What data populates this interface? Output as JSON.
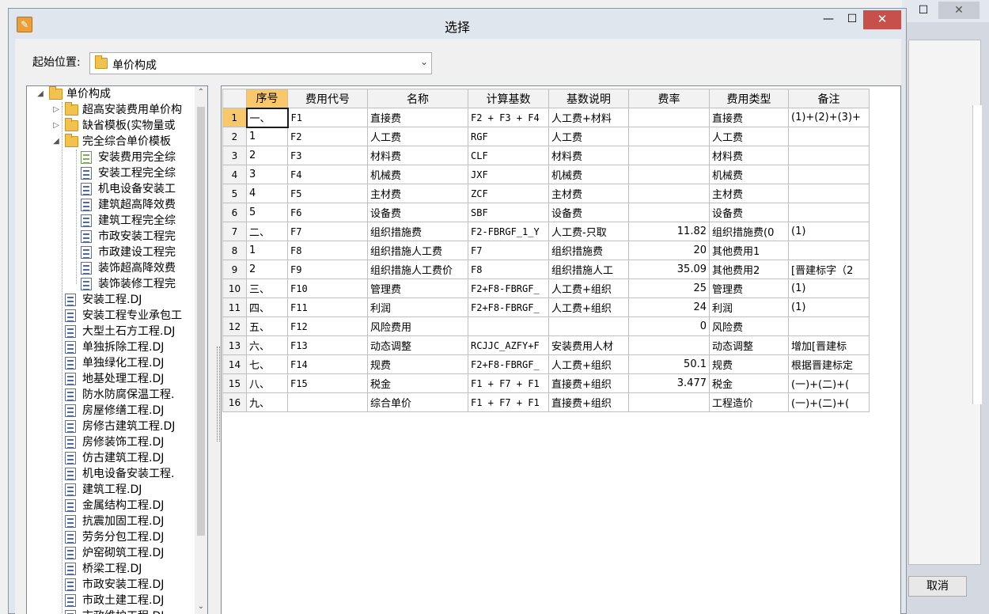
{
  "dialog": {
    "title": "选择",
    "icon": "app-icon",
    "min_label": "—",
    "max_label": "☐",
    "close_label": "✕"
  },
  "background_window": {
    "min_label": "☐",
    "close_label": "✕",
    "cancel_label": "取消"
  },
  "location": {
    "label": "起始位置:",
    "value": "单价构成"
  },
  "tree": {
    "root": "单价构成",
    "nodes": [
      {
        "label": "超高安装费用单价构",
        "type": "folder",
        "level": 1,
        "expander": "collapsed"
      },
      {
        "label": "缺省模板(实物量或",
        "type": "folder",
        "level": 1,
        "expander": "collapsed"
      },
      {
        "label": "完全综合单价模板",
        "type": "folder",
        "level": 1,
        "expander": "expanded"
      },
      {
        "label": "安装费用完全综",
        "type": "doc-green",
        "level": 2
      },
      {
        "label": "安装工程完全综",
        "type": "doc",
        "level": 2
      },
      {
        "label": "机电设备安装工",
        "type": "doc",
        "level": 2
      },
      {
        "label": "建筑超高降效费",
        "type": "doc",
        "level": 2
      },
      {
        "label": "建筑工程完全综",
        "type": "doc",
        "level": 2
      },
      {
        "label": "市政安装工程完",
        "type": "doc",
        "level": 2
      },
      {
        "label": "市政建设工程完",
        "type": "doc",
        "level": 2
      },
      {
        "label": "装饰超高降效费",
        "type": "doc",
        "level": 2
      },
      {
        "label": "装饰装修工程完",
        "type": "doc",
        "level": 2
      },
      {
        "label": "安装工程.DJ",
        "type": "doc",
        "level": 1
      },
      {
        "label": "安装工程专业承包工",
        "type": "doc",
        "level": 1
      },
      {
        "label": "大型土石方工程.DJ",
        "type": "doc",
        "level": 1
      },
      {
        "label": "单独拆除工程.DJ",
        "type": "doc",
        "level": 1
      },
      {
        "label": "单独绿化工程.DJ",
        "type": "doc",
        "level": 1
      },
      {
        "label": "地基处理工程.DJ",
        "type": "doc",
        "level": 1
      },
      {
        "label": "防水防腐保温工程.",
        "type": "doc",
        "level": 1
      },
      {
        "label": "房屋修缮工程.DJ",
        "type": "doc",
        "level": 1
      },
      {
        "label": "房修古建筑工程.DJ",
        "type": "doc",
        "level": 1
      },
      {
        "label": "房修装饰工程.DJ",
        "type": "doc",
        "level": 1
      },
      {
        "label": "仿古建筑工程.DJ",
        "type": "doc",
        "level": 1
      },
      {
        "label": "机电设备安装工程.",
        "type": "doc",
        "level": 1
      },
      {
        "label": "建筑工程.DJ",
        "type": "doc",
        "level": 1
      },
      {
        "label": "金属结构工程.DJ",
        "type": "doc",
        "level": 1
      },
      {
        "label": "抗震加固工程.DJ",
        "type": "doc",
        "level": 1
      },
      {
        "label": "劳务分包工程.DJ",
        "type": "doc",
        "level": 1
      },
      {
        "label": "炉窑砌筑工程.DJ",
        "type": "doc",
        "level": 1
      },
      {
        "label": "桥梁工程.DJ",
        "type": "doc",
        "level": 1
      },
      {
        "label": "市政安装工程.DJ",
        "type": "doc",
        "level": 1
      },
      {
        "label": "市政土建工程.DJ",
        "type": "doc",
        "level": 1
      },
      {
        "label": "市政维护工程.DJ",
        "type": "doc",
        "level": 1
      }
    ]
  },
  "grid": {
    "columns": [
      "序号",
      "费用代号",
      "名称",
      "计算基数",
      "基数说明",
      "费率",
      "费用类型",
      "备注"
    ],
    "rows": [
      {
        "n": "1",
        "cells": [
          "一、",
          "F1",
          "直接费",
          "F2 + F3 + F4",
          "人工费+材料",
          "",
          "直接费",
          "(1)+(2)+(3)+"
        ]
      },
      {
        "n": "2",
        "cells": [
          "1",
          "F2",
          "人工费",
          "RGF",
          "人工费",
          "",
          "人工费",
          ""
        ]
      },
      {
        "n": "3",
        "cells": [
          "2",
          "F3",
          "材料费",
          "CLF",
          "材料费",
          "",
          "材料费",
          ""
        ]
      },
      {
        "n": "4",
        "cells": [
          "3",
          "F4",
          "机械费",
          "JXF",
          "机械费",
          "",
          "机械费",
          ""
        ]
      },
      {
        "n": "5",
        "cells": [
          "4",
          "F5",
          "主材费",
          "ZCF",
          "主材费",
          "",
          "主材费",
          ""
        ]
      },
      {
        "n": "6",
        "cells": [
          "5",
          "F6",
          "设备费",
          "SBF",
          "设备费",
          "",
          "设备费",
          ""
        ]
      },
      {
        "n": "7",
        "cells": [
          "二、",
          "F7",
          "组织措施费",
          "F2-FBRGF_1_Y",
          "人工费-只取",
          "11.82",
          "组织措施费(0",
          "(1)"
        ]
      },
      {
        "n": "8",
        "cells": [
          "1",
          "F8",
          "组织措施人工费",
          "F7",
          "组织措施费",
          "20",
          "其他费用1",
          ""
        ]
      },
      {
        "n": "9",
        "cells": [
          "2",
          "F9",
          "组织措施人工费价",
          "F8",
          "组织措施人工",
          "35.09",
          "其他费用2",
          "[晋建标字（2"
        ]
      },
      {
        "n": "10",
        "cells": [
          "三、",
          "F10",
          "管理费",
          "F2+F8-FBRGF_",
          "人工费+组织",
          "25",
          "管理费",
          "(1)"
        ]
      },
      {
        "n": "11",
        "cells": [
          "四、",
          "F11",
          "利润",
          "F2+F8-FBRGF_",
          "人工费+组织",
          "24",
          "利润",
          "(1)"
        ]
      },
      {
        "n": "12",
        "cells": [
          "五、",
          "F12",
          "风险费用",
          "",
          "",
          "0",
          "风险费",
          ""
        ]
      },
      {
        "n": "13",
        "cells": [
          "六、",
          "F13",
          "动态调整",
          "RCJJC_AZFY+F",
          "安装费用人材",
          "",
          "动态调整",
          "增加[晋建标"
        ]
      },
      {
        "n": "14",
        "cells": [
          "七、",
          "F14",
          "规费",
          "F2+F8-FBRGF_",
          "人工费+组织",
          "50.1",
          "规费",
          "根据晋建标定"
        ]
      },
      {
        "n": "15",
        "cells": [
          "八、",
          "F15",
          "税金",
          "F1 + F7 + F1",
          "直接费+组织",
          "3.477",
          "税金",
          "(一)+(二)+("
        ]
      },
      {
        "n": "16",
        "cells": [
          "九、",
          "",
          "综合单价",
          "F1 + F7 + F1",
          "直接费+组织",
          "",
          "工程造价",
          "(一)+(二)+("
        ]
      }
    ]
  }
}
